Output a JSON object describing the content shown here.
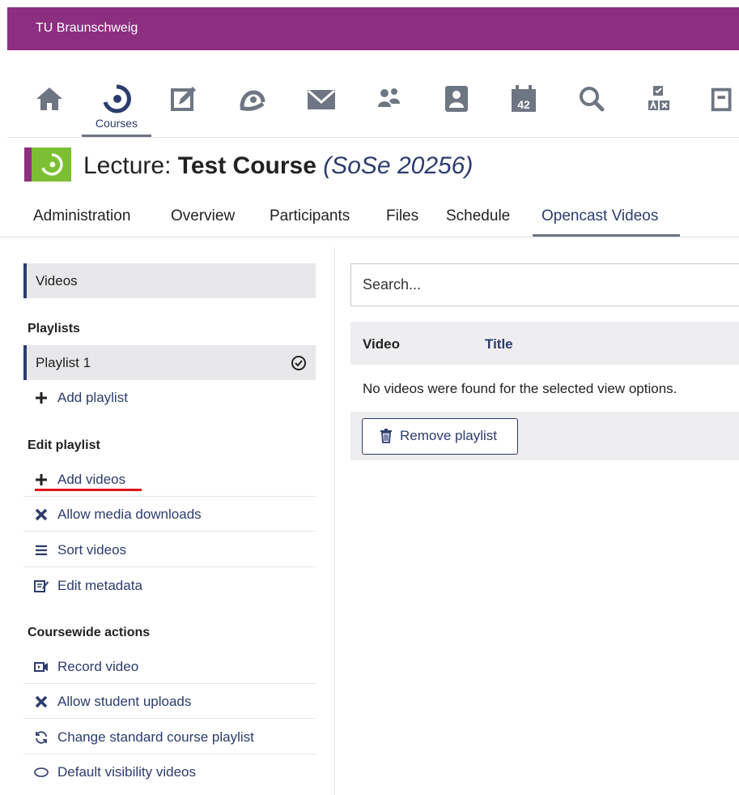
{
  "header": {
    "brand": "TU Braunschweig"
  },
  "nav": {
    "active_label": "Courses",
    "icons": [
      "home-icon",
      "courses-icon",
      "edit-icon",
      "community-icon",
      "mail-icon",
      "people-icon",
      "contact-icon",
      "calendar-icon",
      "search-icon",
      "tools-icon",
      "more-icon"
    ],
    "calendar_number": "42"
  },
  "course": {
    "prefix": "Lecture: ",
    "name": "Test Course",
    "semester": "(SoSe 20256)"
  },
  "tabs": [
    "Administration",
    "Overview",
    "Participants",
    "Files",
    "Schedule",
    "Opencast Videos"
  ],
  "sidebar": {
    "videos_label": "Videos",
    "playlists_heading": "Playlists",
    "playlist_selected": "Playlist 1",
    "add_playlist": "Add playlist",
    "edit_heading": "Edit playlist",
    "edit_items": [
      "Add videos",
      "Allow media downloads",
      "Sort videos",
      "Edit metadata"
    ],
    "course_heading": "Coursewide actions",
    "course_items": [
      "Record video",
      "Allow student uploads",
      "Change standard course playlist",
      "Default visibility videos"
    ]
  },
  "main": {
    "search_placeholder": "Search...",
    "col_video": "Video",
    "col_title": "Title",
    "empty_message": "No videos were found for the selected view options.",
    "remove_button": "Remove playlist"
  },
  "colors": {
    "brand": "#8c2f80",
    "accent": "#2b3c6e",
    "course_logo": "#7cbf34",
    "highlight": "#e3101c"
  }
}
